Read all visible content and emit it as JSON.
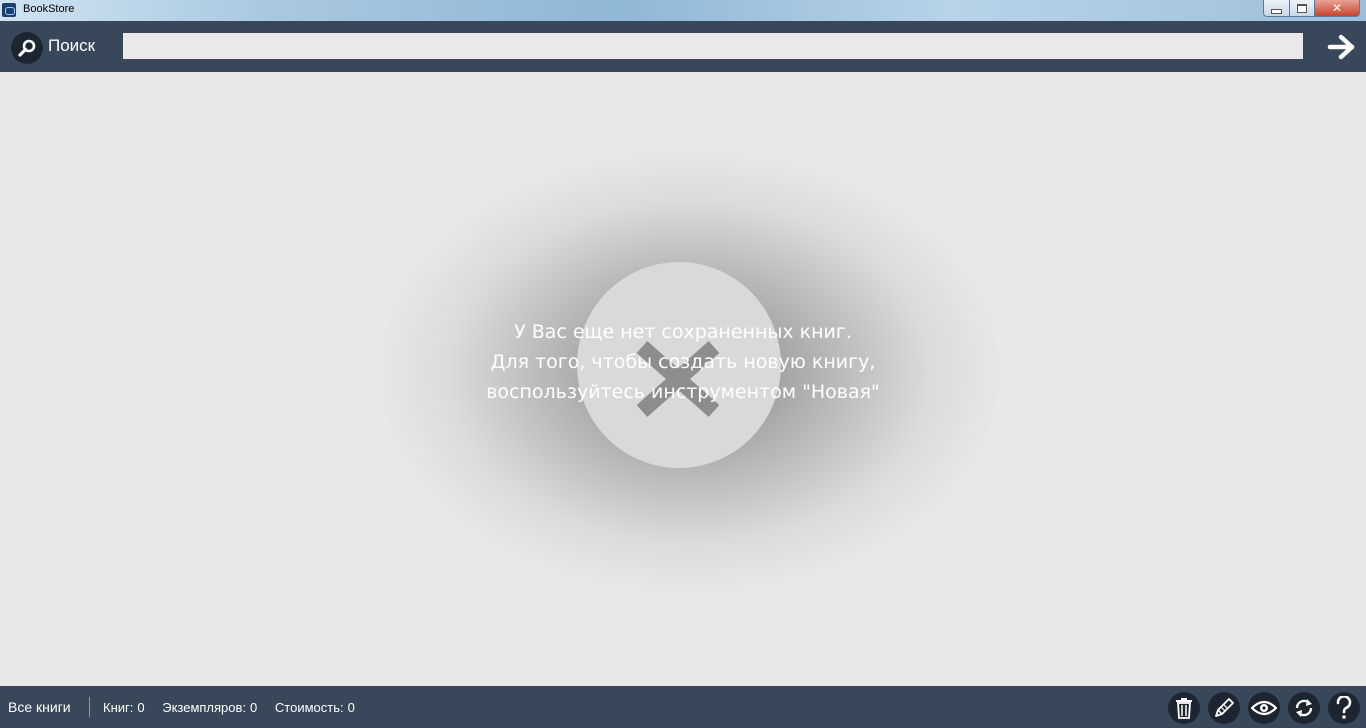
{
  "window": {
    "title": "BookStore"
  },
  "search": {
    "label": "Поиск",
    "value": "",
    "placeholder": ""
  },
  "empty_state": {
    "line1": "У Вас еще нет сохраненных книг.",
    "line2": "Для того, чтобы создать новую книгу,",
    "line3": "воспользуйтесь инструментом \"Новая\""
  },
  "status": {
    "filter": "Все книги",
    "books_label": "Книг:",
    "books_value": "0",
    "copies_label": "Экземпляров:",
    "copies_value": "0",
    "cost_label": "Стоимость:",
    "cost_value": "0"
  },
  "toolbar_icons": [
    "trash-icon",
    "pencil-icon",
    "eye-icon",
    "refresh-icon",
    "help-icon"
  ],
  "colors": {
    "bar": "#38475a",
    "background": "#e8e8e8",
    "icon_circle": "#1d2530"
  }
}
